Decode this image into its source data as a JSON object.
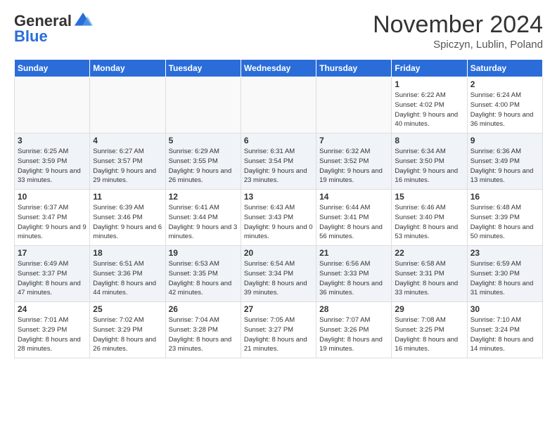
{
  "header": {
    "logo_general": "General",
    "logo_blue": "Blue",
    "month_title": "November 2024",
    "location": "Spiczyn, Lublin, Poland"
  },
  "weekdays": [
    "Sunday",
    "Monday",
    "Tuesday",
    "Wednesday",
    "Thursday",
    "Friday",
    "Saturday"
  ],
  "weeks": [
    [
      {
        "day": "",
        "info": ""
      },
      {
        "day": "",
        "info": ""
      },
      {
        "day": "",
        "info": ""
      },
      {
        "day": "",
        "info": ""
      },
      {
        "day": "",
        "info": ""
      },
      {
        "day": "1",
        "info": "Sunrise: 6:22 AM\nSunset: 4:02 PM\nDaylight: 9 hours and 40 minutes."
      },
      {
        "day": "2",
        "info": "Sunrise: 6:24 AM\nSunset: 4:00 PM\nDaylight: 9 hours and 36 minutes."
      }
    ],
    [
      {
        "day": "3",
        "info": "Sunrise: 6:25 AM\nSunset: 3:59 PM\nDaylight: 9 hours and 33 minutes."
      },
      {
        "day": "4",
        "info": "Sunrise: 6:27 AM\nSunset: 3:57 PM\nDaylight: 9 hours and 29 minutes."
      },
      {
        "day": "5",
        "info": "Sunrise: 6:29 AM\nSunset: 3:55 PM\nDaylight: 9 hours and 26 minutes."
      },
      {
        "day": "6",
        "info": "Sunrise: 6:31 AM\nSunset: 3:54 PM\nDaylight: 9 hours and 23 minutes."
      },
      {
        "day": "7",
        "info": "Sunrise: 6:32 AM\nSunset: 3:52 PM\nDaylight: 9 hours and 19 minutes."
      },
      {
        "day": "8",
        "info": "Sunrise: 6:34 AM\nSunset: 3:50 PM\nDaylight: 9 hours and 16 minutes."
      },
      {
        "day": "9",
        "info": "Sunrise: 6:36 AM\nSunset: 3:49 PM\nDaylight: 9 hours and 13 minutes."
      }
    ],
    [
      {
        "day": "10",
        "info": "Sunrise: 6:37 AM\nSunset: 3:47 PM\nDaylight: 9 hours and 9 minutes."
      },
      {
        "day": "11",
        "info": "Sunrise: 6:39 AM\nSunset: 3:46 PM\nDaylight: 9 hours and 6 minutes."
      },
      {
        "day": "12",
        "info": "Sunrise: 6:41 AM\nSunset: 3:44 PM\nDaylight: 9 hours and 3 minutes."
      },
      {
        "day": "13",
        "info": "Sunrise: 6:43 AM\nSunset: 3:43 PM\nDaylight: 9 hours and 0 minutes."
      },
      {
        "day": "14",
        "info": "Sunrise: 6:44 AM\nSunset: 3:41 PM\nDaylight: 8 hours and 56 minutes."
      },
      {
        "day": "15",
        "info": "Sunrise: 6:46 AM\nSunset: 3:40 PM\nDaylight: 8 hours and 53 minutes."
      },
      {
        "day": "16",
        "info": "Sunrise: 6:48 AM\nSunset: 3:39 PM\nDaylight: 8 hours and 50 minutes."
      }
    ],
    [
      {
        "day": "17",
        "info": "Sunrise: 6:49 AM\nSunset: 3:37 PM\nDaylight: 8 hours and 47 minutes."
      },
      {
        "day": "18",
        "info": "Sunrise: 6:51 AM\nSunset: 3:36 PM\nDaylight: 8 hours and 44 minutes."
      },
      {
        "day": "19",
        "info": "Sunrise: 6:53 AM\nSunset: 3:35 PM\nDaylight: 8 hours and 42 minutes."
      },
      {
        "day": "20",
        "info": "Sunrise: 6:54 AM\nSunset: 3:34 PM\nDaylight: 8 hours and 39 minutes."
      },
      {
        "day": "21",
        "info": "Sunrise: 6:56 AM\nSunset: 3:33 PM\nDaylight: 8 hours and 36 minutes."
      },
      {
        "day": "22",
        "info": "Sunrise: 6:58 AM\nSunset: 3:31 PM\nDaylight: 8 hours and 33 minutes."
      },
      {
        "day": "23",
        "info": "Sunrise: 6:59 AM\nSunset: 3:30 PM\nDaylight: 8 hours and 31 minutes."
      }
    ],
    [
      {
        "day": "24",
        "info": "Sunrise: 7:01 AM\nSunset: 3:29 PM\nDaylight: 8 hours and 28 minutes."
      },
      {
        "day": "25",
        "info": "Sunrise: 7:02 AM\nSunset: 3:29 PM\nDaylight: 8 hours and 26 minutes."
      },
      {
        "day": "26",
        "info": "Sunrise: 7:04 AM\nSunset: 3:28 PM\nDaylight: 8 hours and 23 minutes."
      },
      {
        "day": "27",
        "info": "Sunrise: 7:05 AM\nSunset: 3:27 PM\nDaylight: 8 hours and 21 minutes."
      },
      {
        "day": "28",
        "info": "Sunrise: 7:07 AM\nSunset: 3:26 PM\nDaylight: 8 hours and 19 minutes."
      },
      {
        "day": "29",
        "info": "Sunrise: 7:08 AM\nSunset: 3:25 PM\nDaylight: 8 hours and 16 minutes."
      },
      {
        "day": "30",
        "info": "Sunrise: 7:10 AM\nSunset: 3:24 PM\nDaylight: 8 hours and 14 minutes."
      }
    ]
  ]
}
